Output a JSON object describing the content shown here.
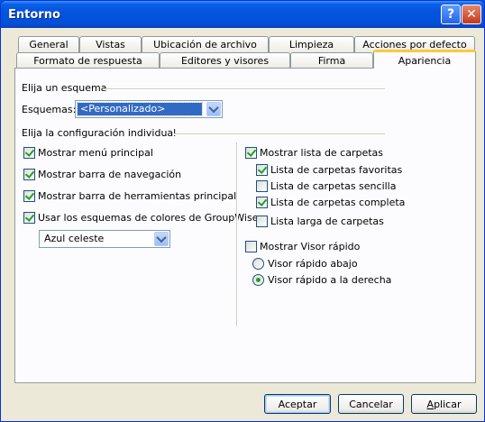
{
  "window": {
    "title": "Entorno",
    "help_glyph": "?",
    "close_glyph": "✕"
  },
  "tabs": {
    "row_back": [
      "General",
      "Vistas",
      "Ubicación de archivo",
      "Limpieza",
      "Acciones por defecto"
    ],
    "row_front": [
      "Formato de respuesta",
      "Editores y visores",
      "Firma",
      "Apariencia"
    ],
    "active": "Apariencia"
  },
  "scheme_group": {
    "title": "Elija un esquema",
    "label": "Esquemas:",
    "selected": "<Personalizado>"
  },
  "individual_group": {
    "title": "Elija la configuración individual",
    "left": [
      {
        "label": "Mostrar menú principal",
        "checked": true
      },
      {
        "label": "Mostrar barra de navegación",
        "checked": true
      },
      {
        "label": "Mostrar barra de herramientas principal",
        "checked": true
      },
      {
        "label": "Usar los esquemas de colores de GroupWise",
        "checked": true
      }
    ],
    "color_scheme": "Azul celeste",
    "right": {
      "folder_list": {
        "label": "Mostrar lista de carpetas",
        "checked": true
      },
      "folder_options": [
        {
          "label": "Lista de carpetas favoritas",
          "checked": true
        },
        {
          "label": "Lista de carpetas sencilla",
          "checked": false
        },
        {
          "label": "Lista de carpetas completa",
          "checked": true
        },
        {
          "label": "Lista larga de carpetas",
          "checked": false
        }
      ],
      "quick_viewer": {
        "label": "Mostrar Visor rápido",
        "checked": false
      },
      "quick_viewer_options": [
        {
          "label": "Visor rápido abajo",
          "selected": false
        },
        {
          "label": "Visor rápido a la derecha",
          "selected": true
        }
      ]
    }
  },
  "buttons": {
    "ok": "Aceptar",
    "cancel": "Cancelar",
    "apply_first": "A",
    "apply_rest": "plicar"
  }
}
